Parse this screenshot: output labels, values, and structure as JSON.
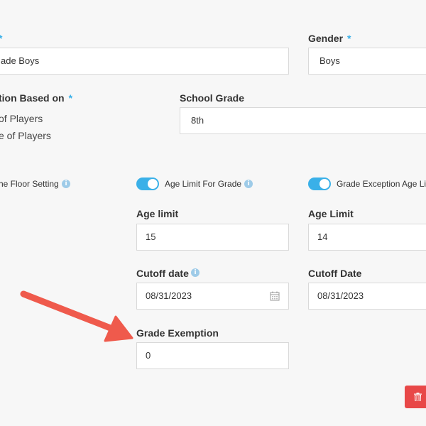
{
  "form": {
    "name": {
      "label_fragment": "",
      "required_mark": "*",
      "value": "ade Boys"
    },
    "gender": {
      "label": "Gender",
      "required_mark": "*",
      "value": "Boys"
    },
    "division_based_on": {
      "label": "tion Based on",
      "required_mark": "*",
      "options": [
        "of Players",
        "e of Players"
      ]
    },
    "school_grade": {
      "label": "School Grade",
      "value": "8th"
    },
    "toggles": {
      "floor_setting": {
        "label": "he Floor Setting"
      },
      "age_limit_for_grade": {
        "label": "Age Limit For Grade",
        "on": true
      },
      "grade_exception_age_limit": {
        "label": "Grade Exception Age Lim",
        "on": true
      }
    },
    "age_limit": {
      "label": "Age limit",
      "value": "15"
    },
    "age_limit_exception": {
      "label": "Age Limit",
      "value": "14"
    },
    "cutoff_date": {
      "label": "Cutoff date",
      "value": "08/31/2023"
    },
    "cutoff_date_exception": {
      "label": "Cutoff Date",
      "value": "08/31/2023"
    },
    "grade_exemption": {
      "label": "Grade Exemption",
      "value": "0"
    }
  },
  "icons": {
    "info": "info-icon",
    "calendar": "calendar-icon",
    "trash": "trash-icon",
    "annotation_arrow": "arrow-annotation"
  },
  "colors": {
    "accent": "#3ab0e8",
    "danger": "#e84848",
    "annotation": "#ef5a4c"
  }
}
